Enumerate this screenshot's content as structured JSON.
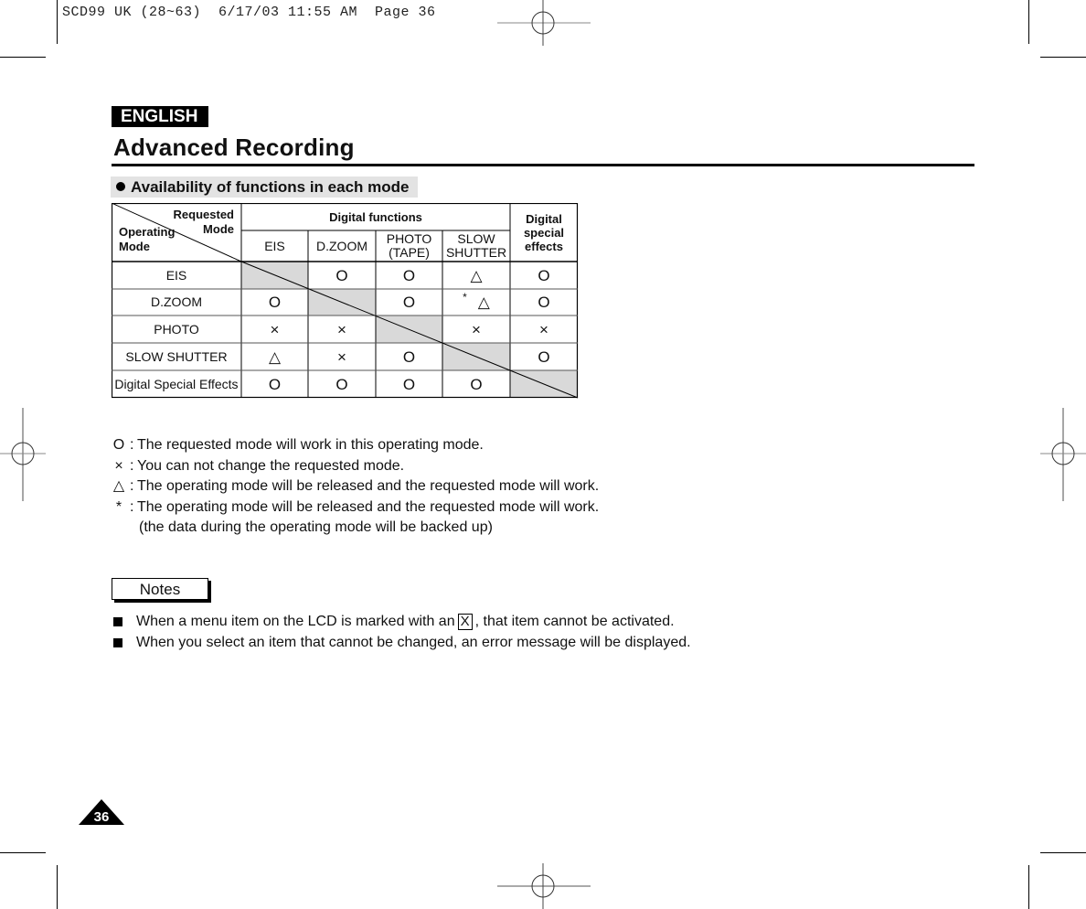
{
  "print_slug": "SCD99 UK (28~63)  6/17/03 11:55 AM  Page 36",
  "language_tab": "ENGLISH",
  "page_title": "Advanced Recording",
  "section_heading": "Availability of functions in each mode",
  "table": {
    "corner": {
      "requested": "Requested",
      "mode": "Mode",
      "operating": "Operating",
      "operating_mode": "Mode"
    },
    "group_header": "Digital functions",
    "special_header": [
      "Digital",
      "special",
      "effects"
    ],
    "columns": [
      {
        "label1": "EIS",
        "label2": ""
      },
      {
        "label1": "D.ZOOM",
        "label2": ""
      },
      {
        "label1": "PHOTO",
        "label2": "(TAPE)"
      },
      {
        "label1": "SLOW",
        "label2": "SHUTTER"
      }
    ],
    "rows": [
      {
        "label": "EIS",
        "cells": [
          "",
          "O",
          "O",
          "△",
          "O"
        ]
      },
      {
        "label": "D.ZOOM",
        "cells": [
          "O",
          "",
          "O",
          "* △",
          "O"
        ]
      },
      {
        "label": "PHOTO",
        "cells": [
          "×",
          "×",
          "",
          "×",
          "×"
        ]
      },
      {
        "label": "SLOW SHUTTER",
        "cells": [
          "△",
          "×",
          "O",
          "",
          "O"
        ]
      },
      {
        "label": "Digital Special Effects",
        "cells": [
          "O",
          "O",
          "O",
          "O",
          ""
        ]
      }
    ]
  },
  "legend": [
    {
      "key": "O",
      "text": "The requested mode will work in this operating mode."
    },
    {
      "key": "×",
      "text": "You can not change the requested mode."
    },
    {
      "key": "△",
      "text": "The operating mode will be released and the requested mode will work."
    },
    {
      "key": "*",
      "text": "The operating mode will be released and the requested mode will work."
    }
  ],
  "legend_note": "(the data during the operating mode will be backed up)",
  "notes_label": "Notes",
  "notes": [
    {
      "before": "When a menu item on the LCD is marked with an",
      "boxed": "X",
      "after": ", that item cannot be activated."
    },
    {
      "before": "When you select an item that cannot be changed, an error message will be displayed.",
      "boxed": "",
      "after": ""
    }
  ],
  "page_number": "36",
  "colors": {
    "shade": "#d9d9d9",
    "heading_bg": "#e3e3e3",
    "ink": "#000000"
  }
}
